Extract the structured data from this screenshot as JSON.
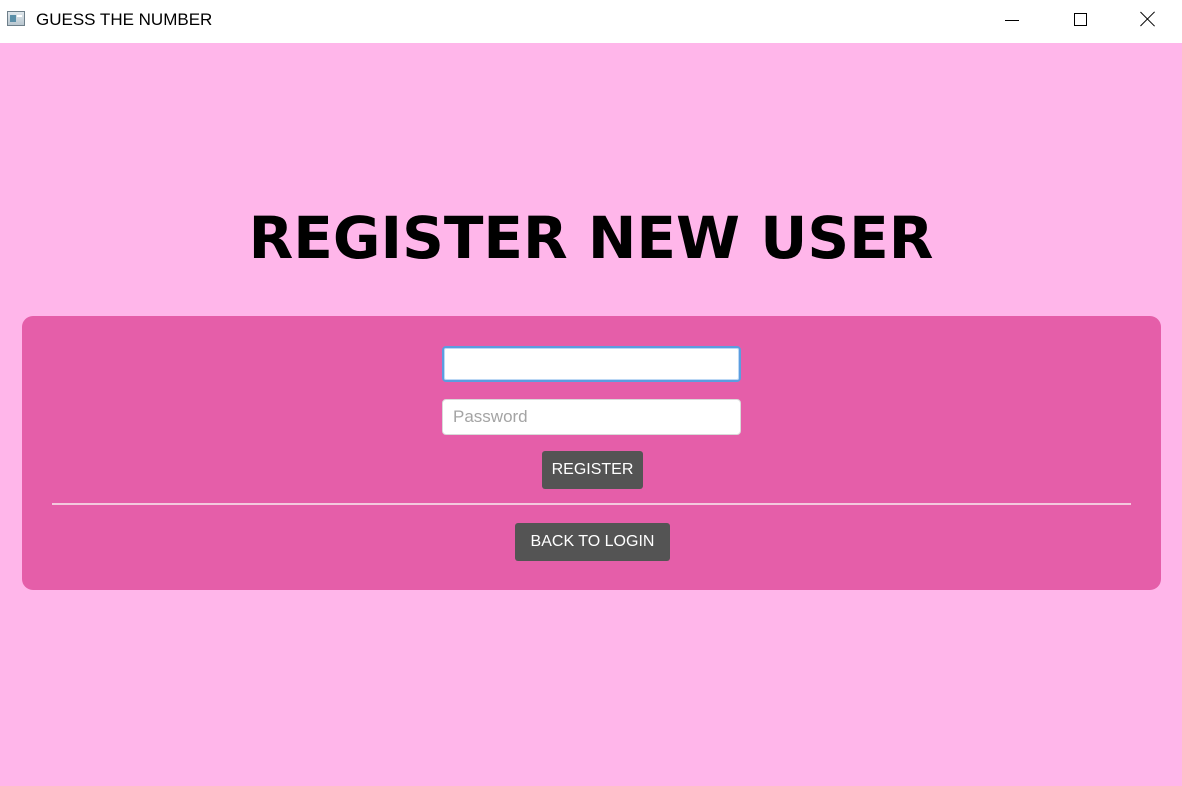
{
  "window": {
    "title": "GUESS THE NUMBER",
    "icon": "app-window-icon",
    "controls": {
      "minimize_icon": "minimize-icon",
      "maximize_icon": "maximize-icon",
      "close_icon": "close-icon"
    }
  },
  "page": {
    "heading": "REGISTER NEW USER",
    "colors": {
      "background": "#ffb6ea",
      "panel": "#e55ea9",
      "button": "#545454"
    }
  },
  "form": {
    "username": {
      "value": "",
      "placeholder": ""
    },
    "password": {
      "value": "",
      "placeholder": "Password"
    },
    "register_label": "REGISTER",
    "back_label": "BACK TO LOGIN"
  }
}
